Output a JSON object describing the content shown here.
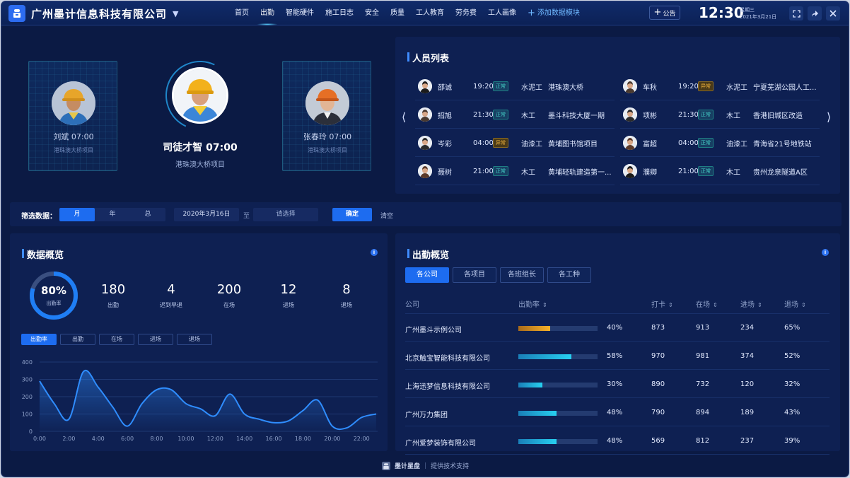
{
  "header": {
    "company": "广州墨计信息科技有限公司",
    "nav": [
      {
        "label": "首页",
        "active": false
      },
      {
        "label": "出勤",
        "active": true
      },
      {
        "label": "智能硬件",
        "active": false
      },
      {
        "label": "施工日志",
        "active": false
      },
      {
        "label": "安全",
        "active": false
      },
      {
        "label": "质量",
        "active": false
      },
      {
        "label": "工人教育",
        "active": false
      },
      {
        "label": "劳务费",
        "active": false
      },
      {
        "label": "工人画像",
        "active": false
      }
    ],
    "add_module": "添加数据模块",
    "notice": "公告",
    "time": "12:30",
    "weekday": "星期三",
    "date": "2021年3月21日"
  },
  "workers": {
    "left": {
      "name_time": "刘斌 07:00",
      "site": "港珠澳大桥项目"
    },
    "center": {
      "name_time": "司徒才智 07:00",
      "site": "港珠澳大桥项目"
    },
    "right": {
      "name_time": "张春玲 07:00",
      "site": "港珠澳大桥项目"
    }
  },
  "people_list": {
    "title": "人员列表",
    "left": [
      {
        "name": "邵诚",
        "time": "19:20",
        "status": "正常",
        "ok": true,
        "trade": "水泥工",
        "project": "港珠澳大桥"
      },
      {
        "name": "招旭",
        "time": "21:30",
        "status": "正常",
        "ok": true,
        "trade": "木工",
        "project": "墨斗科技大厦一期"
      },
      {
        "name": "岑彩",
        "time": "04:00",
        "status": "异常",
        "ok": false,
        "trade": "油漆工",
        "project": "黄埔图书馆项目"
      },
      {
        "name": "聂树",
        "time": "21:00",
        "status": "正常",
        "ok": true,
        "trade": "木工",
        "project": "黄埔轻轨建造第一..."
      }
    ],
    "right": [
      {
        "name": "车秋",
        "time": "19:20",
        "status": "异常",
        "ok": false,
        "trade": "水泥工",
        "project": "宁夏芜湖公园人工..."
      },
      {
        "name": "项彬",
        "time": "21:30",
        "status": "正常",
        "ok": true,
        "trade": "木工",
        "project": "香港旧城区改造"
      },
      {
        "name": "富超",
        "time": "04:00",
        "status": "正常",
        "ok": true,
        "trade": "油漆工",
        "project": "青海省21号地铁站"
      },
      {
        "name": "濮卿",
        "time": "21:00",
        "status": "正常",
        "ok": true,
        "trade": "木工",
        "project": "贵州龙泉隧道A区"
      }
    ]
  },
  "filter": {
    "label": "筛选数据：",
    "periods": [
      {
        "label": "月",
        "active": true
      },
      {
        "label": "年",
        "active": false
      },
      {
        "label": "总",
        "active": false
      }
    ],
    "start_date": "2020年3月16日",
    "to": "至",
    "end_placeholder": "请选择",
    "confirm": "确定",
    "clear": "清空"
  },
  "overview": {
    "title": "数据概览",
    "rate": "80%",
    "rate_value": 80,
    "rate_label": "出勤率",
    "stats": [
      {
        "value": "180",
        "label": "出勤"
      },
      {
        "value": "4",
        "label": "迟到早退"
      },
      {
        "value": "200",
        "label": "在场"
      },
      {
        "value": "12",
        "label": "进场"
      },
      {
        "value": "8",
        "label": "退场"
      }
    ],
    "tabs": [
      {
        "label": "出勤率",
        "active": true
      },
      {
        "label": "出勤",
        "active": false
      },
      {
        "label": "在场",
        "active": false
      },
      {
        "label": "进场",
        "active": false
      },
      {
        "label": "退场",
        "active": false
      }
    ]
  },
  "chart_data": {
    "type": "area",
    "x": [
      "0:00",
      "1:00",
      "2:00",
      "3:00",
      "4:00",
      "5:00",
      "6:00",
      "7:00",
      "8:00",
      "9:00",
      "10:00",
      "11:00",
      "12:00",
      "13:00",
      "14:00",
      "15:00",
      "16:00",
      "17:00",
      "18:00",
      "19:00",
      "20:00",
      "21:00",
      "22:00",
      "23:00"
    ],
    "x_ticks": [
      "0:00",
      "2:00",
      "4:00",
      "6:00",
      "8:00",
      "10:00",
      "12:00",
      "14:00",
      "16:00",
      "18:00",
      "20:00",
      "22:00"
    ],
    "values": [
      290,
      160,
      70,
      345,
      255,
      140,
      30,
      160,
      240,
      240,
      160,
      130,
      90,
      215,
      100,
      70,
      50,
      60,
      120,
      180,
      30,
      20,
      80,
      100
    ],
    "y_ticks": [
      "0",
      "100",
      "200",
      "300",
      "400"
    ],
    "ylim": [
      0,
      400
    ],
    "grid": true,
    "color": "#2f8dff"
  },
  "attendance": {
    "title": "出勤概览",
    "tabs": [
      {
        "label": "各公司",
        "active": true
      },
      {
        "label": "各项目",
        "active": false
      },
      {
        "label": "各班组长",
        "active": false
      },
      {
        "label": "各工种",
        "active": false
      }
    ],
    "columns": [
      "公司",
      "出勤率",
      "打卡",
      "在场",
      "进场",
      "退场"
    ],
    "rows": [
      {
        "company": "广州墨斗示例公司",
        "rate": "40%",
        "rate_value": 0.4,
        "color": "#f0a22a",
        "clock": "873",
        "onsite": "913",
        "enter": "234",
        "exit": "65%"
      },
      {
        "company": "北京触宝智能科技有限公司",
        "rate": "58%",
        "rate_value": 0.67,
        "color": "#1fb6e6",
        "clock": "970",
        "onsite": "981",
        "enter": "374",
        "exit": "52%"
      },
      {
        "company": "上海迅梦信息科技有限公司",
        "rate": "30%",
        "rate_value": 0.3,
        "color": "#1fb6e6",
        "clock": "890",
        "onsite": "732",
        "enter": "120",
        "exit": "32%"
      },
      {
        "company": "广州万力集团",
        "rate": "48%",
        "rate_value": 0.48,
        "color": "#1fb6e6",
        "clock": "790",
        "onsite": "894",
        "enter": "189",
        "exit": "43%"
      },
      {
        "company": "广州爱梦装饰有限公司",
        "rate": "48%",
        "rate_value": 0.48,
        "color": "#1fb6e6",
        "clock": "569",
        "onsite": "812",
        "enter": "237",
        "exit": "39%"
      }
    ]
  },
  "footer": {
    "brand": "墨计星盘",
    "support": "提供技术支持"
  }
}
